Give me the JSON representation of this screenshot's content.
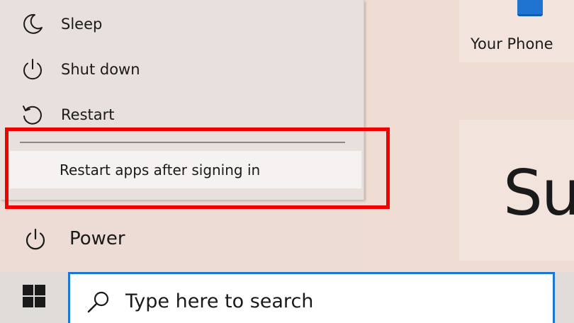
{
  "power_menu": {
    "items": [
      {
        "label": "Sleep",
        "icon": "moon-icon"
      },
      {
        "label": "Shut down",
        "icon": "power-icon"
      },
      {
        "label": "Restart",
        "icon": "restart-icon"
      }
    ],
    "sub_option_label": "Restart apps after signing in"
  },
  "left_rail": {
    "power_label": "Power"
  },
  "tiles": {
    "your_phone_label": "Your Phone",
    "sun_label": "Sun"
  },
  "taskbar": {
    "search_placeholder": "Type here to search",
    "start_icon": "windows-logo-icon",
    "search_icon": "search-icon"
  },
  "colors": {
    "highlight": "#f00000",
    "search_border": "#1a78d4",
    "phone_icon": "#1e74d0"
  }
}
